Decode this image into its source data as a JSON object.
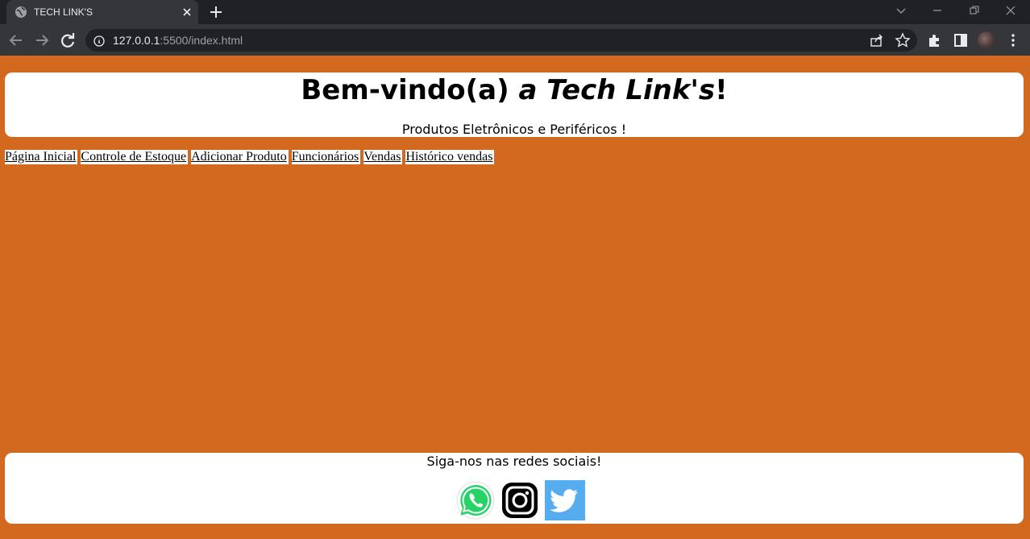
{
  "browser": {
    "tab_title": "TECH LINK'S",
    "url_host": "127.0.0.1",
    "url_rest": ":5500/index.html"
  },
  "header": {
    "welcome_plain": "Bem-vindo(a) ",
    "welcome_italic": "a Tech Link's",
    "welcome_end": "!",
    "tagline": "Produtos Eletrônicos e Periféricos !"
  },
  "nav": {
    "items": [
      {
        "label": "Página Inicial "
      },
      {
        "label": "Controle de Estoque "
      },
      {
        "label": "Adicionar Produto "
      },
      {
        "label": "Funcionários"
      },
      {
        "label": "Vendas"
      },
      {
        "label": "Histórico vendas"
      }
    ]
  },
  "footer": {
    "title": "Siga-nos nas redes sociais!",
    "icons": [
      "whatsapp-icon",
      "instagram-icon",
      "twitter-icon"
    ]
  },
  "colors": {
    "page_background": "#d2691e",
    "panel_background": "#ffffff",
    "whatsapp": "#25d366",
    "twitter": "#55acee"
  }
}
